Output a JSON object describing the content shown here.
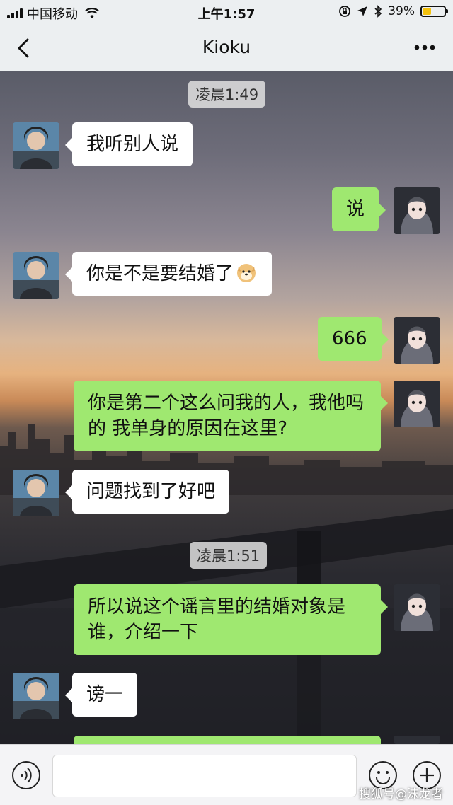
{
  "status": {
    "carrier": "中国移动",
    "time": "上午1:57",
    "battery_percent": "39%",
    "battery_level": 0.39
  },
  "nav": {
    "title": "Kioku",
    "back_icon": "chevron-left-icon",
    "more_icon": "more-dots-icon"
  },
  "timestamps": [
    "凌晨1:49",
    "凌晨1:51"
  ],
  "messages": [
    {
      "side": "in",
      "text": "我听别人说"
    },
    {
      "side": "out",
      "text": "说"
    },
    {
      "side": "in",
      "text": "你是不是要结婚了",
      "emoji": "doge-emoji"
    },
    {
      "side": "out",
      "text": "666"
    },
    {
      "side": "out",
      "text": "你是第二个这么问我的人，我他吗的 我单身的原因在这里?"
    },
    {
      "side": "in",
      "text": "问题找到了好吧"
    },
    {
      "side": "out",
      "text": "所以说这个谣言里的结婚对象是谁，介绍一下"
    },
    {
      "side": "in",
      "text": "谤一"
    }
  ],
  "input": {
    "value": "",
    "voice_icon": "voice-icon",
    "emoji_icon": "smiley-icon",
    "plus_icon": "plus-circle-icon"
  },
  "watermark": "搜狐号@沫龙者",
  "colors": {
    "outgoing_bubble": "#9fe870",
    "incoming_bubble": "#ffffff",
    "nav_bg": "#eceff1"
  }
}
